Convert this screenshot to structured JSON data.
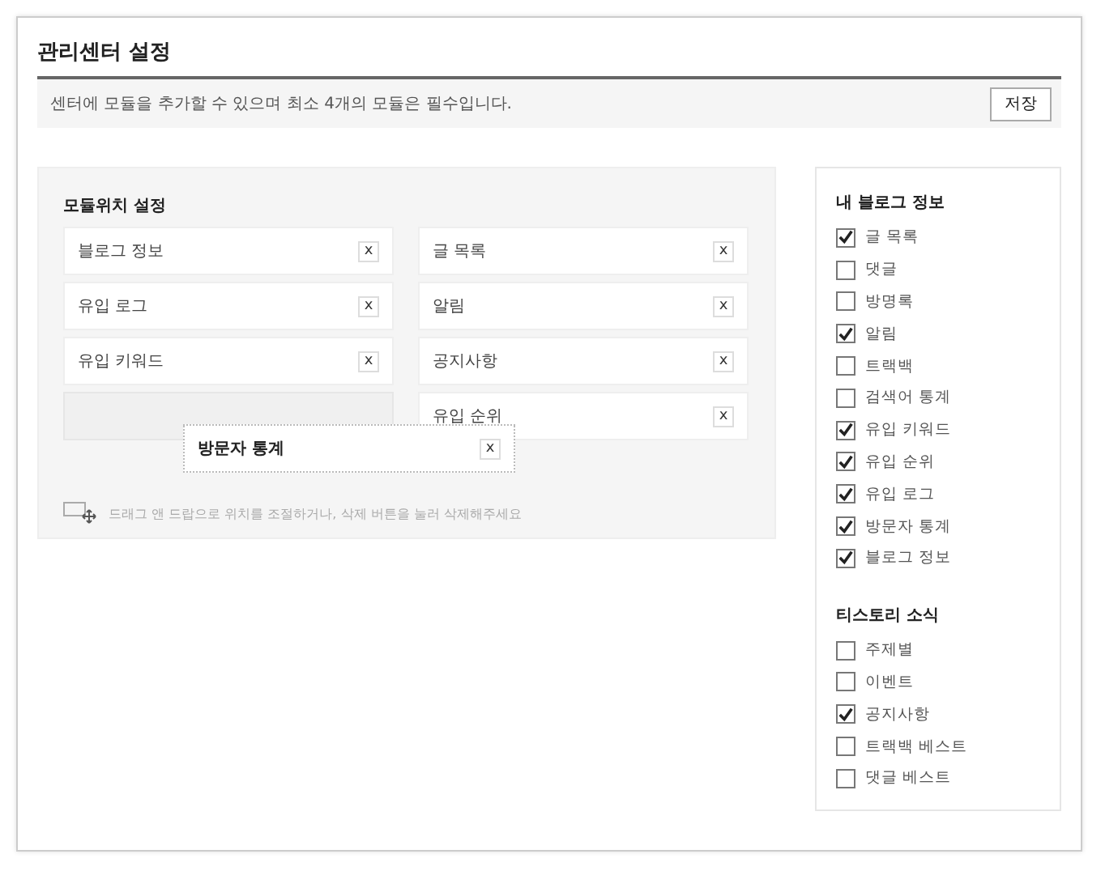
{
  "title": "관리센터 설정",
  "notice": "센터에 모듈을 추가할 수 있으며 최소 4개의 모듈은 필수입니다.",
  "save_button": "저장",
  "layout_panel": {
    "title": "모듈위치 설정",
    "columns": [
      [
        {
          "label": "블로그 정보",
          "remove": "x"
        },
        {
          "label": "유입 로그",
          "remove": "x"
        },
        {
          "label": "유입 키워드",
          "remove": "x"
        },
        {
          "kind": "empty"
        }
      ],
      [
        {
          "label": "글 목록",
          "remove": "x"
        },
        {
          "label": "알림",
          "remove": "x"
        },
        {
          "label": "공지사항",
          "remove": "x"
        },
        {
          "label": "유입 순위",
          "remove": "x"
        }
      ]
    ],
    "dragging": {
      "label": "방문자 통계",
      "remove": "x"
    },
    "hint": "드래그 앤 드랍으로 위치를 조절하거나, 삭제 버튼을 눌러 삭제해주세요"
  },
  "groups": [
    {
      "title": "내 블로그 정보",
      "items": [
        {
          "label": "글 목록",
          "checked": true
        },
        {
          "label": "댓글",
          "checked": false
        },
        {
          "label": "방명록",
          "checked": false
        },
        {
          "label": "알림",
          "checked": true
        },
        {
          "label": "트랙백",
          "checked": false
        },
        {
          "label": "검색어 통계",
          "checked": false
        },
        {
          "label": "유입 키워드",
          "checked": true
        },
        {
          "label": "유입 순위",
          "checked": true
        },
        {
          "label": "유입 로그",
          "checked": true
        },
        {
          "label": "방문자 통계",
          "checked": true
        },
        {
          "label": "블로그 정보",
          "checked": true
        }
      ]
    },
    {
      "title": "티스토리 소식",
      "items": [
        {
          "label": "주제별",
          "checked": false
        },
        {
          "label": "이벤트",
          "checked": false
        },
        {
          "label": "공지사항",
          "checked": true
        },
        {
          "label": "트랙백 베스트",
          "checked": false
        },
        {
          "label": "댓글 베스트",
          "checked": false
        }
      ]
    }
  ]
}
